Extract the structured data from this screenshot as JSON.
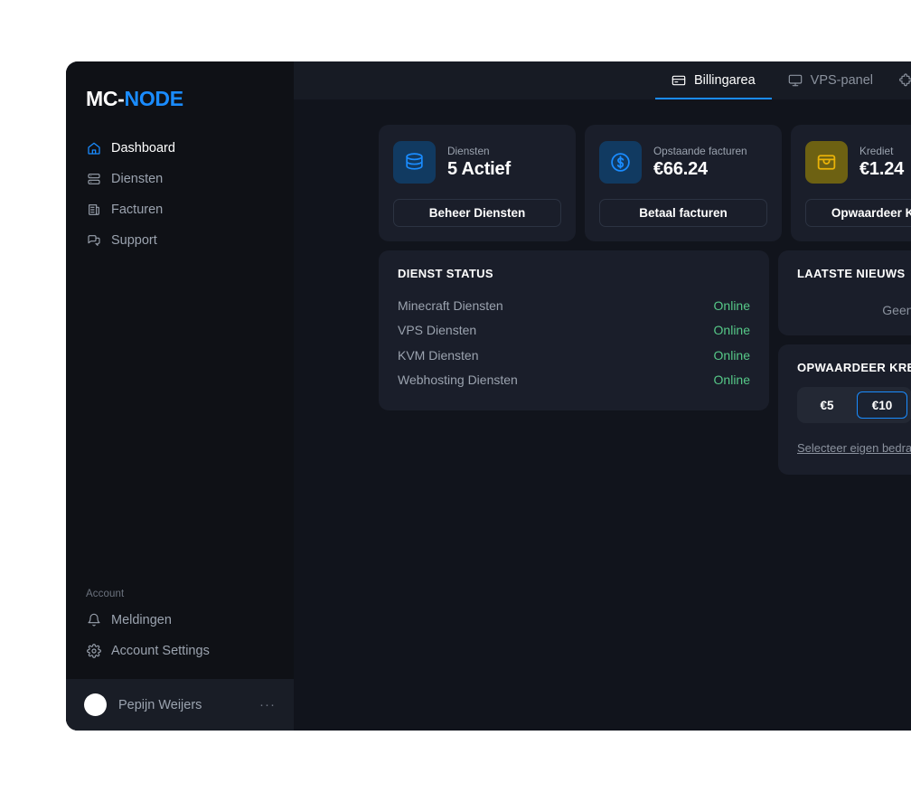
{
  "brand": {
    "part1": "MC-",
    "part2": "NODE"
  },
  "sidebar": {
    "nav": [
      {
        "label": "Dashboard",
        "icon": "home-icon",
        "active": true
      },
      {
        "label": "Diensten",
        "icon": "server-icon",
        "active": false
      },
      {
        "label": "Facturen",
        "icon": "newspaper-icon",
        "active": false
      },
      {
        "label": "Support",
        "icon": "chat-icon",
        "active": false
      }
    ],
    "account_label": "Account",
    "account_items": [
      {
        "label": "Meldingen",
        "icon": "bell-icon"
      },
      {
        "label": "Account Settings",
        "icon": "gear-icon"
      }
    ],
    "user": {
      "name": "Pepijn Weijers",
      "more": "···"
    }
  },
  "topbar": {
    "tabs": [
      {
        "label": "Billingarea",
        "icon": "card-icon",
        "active": true
      },
      {
        "label": "VPS-panel",
        "icon": "monitor-icon",
        "active": false
      },
      {
        "label": "",
        "icon": "puzzle-icon",
        "active": false
      }
    ]
  },
  "stat_cards": [
    {
      "label": "Diensten",
      "value": "5 Actief",
      "button": "Beheer Diensten",
      "icon": "server-stack-icon",
      "tone": "blue"
    },
    {
      "label": "Opstaande facturen",
      "value": "€66.24",
      "button": "Betaal facturen",
      "icon": "dollar-circle-icon",
      "tone": "blue"
    },
    {
      "label": "Krediet",
      "value": "€1.24",
      "button": "Opwaardeer Krediet",
      "icon": "inbox-icon",
      "tone": "amber"
    }
  ],
  "dienst_status": {
    "title": "DIENST STATUS",
    "rows": [
      {
        "name": "Minecraft Diensten",
        "status": "Online"
      },
      {
        "name": "VPS Diensten",
        "status": "Online"
      },
      {
        "name": "KVM Diensten",
        "status": "Online"
      },
      {
        "name": "Webhosting Diensten",
        "status": "Online"
      }
    ]
  },
  "news": {
    "title": "LAATSTE NIEUWS",
    "body": "Geen nieuws"
  },
  "topup": {
    "title": "OPWAARDEER KREDIET",
    "amounts": [
      {
        "label": "€5",
        "selected": false
      },
      {
        "label": "€10",
        "selected": true
      }
    ],
    "custom_link": "Selecteer eigen bedrag"
  },
  "colors": {
    "accent": "#1a8cff",
    "online": "#56c888",
    "amber": "#eab308",
    "card_bg": "#1a1e2a",
    "app_bg": "#11141c",
    "sidebar_bg": "#0f1116"
  }
}
